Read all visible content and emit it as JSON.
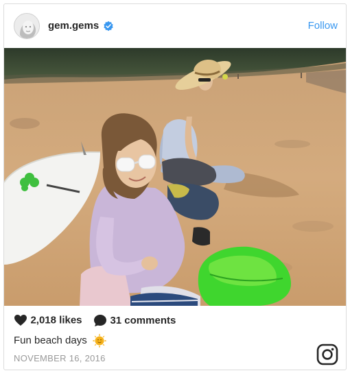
{
  "post": {
    "username": "gem.gems",
    "follow_label": "Follow",
    "likes": "2,018 likes",
    "comments": "31 comments",
    "caption": "Fun beach days",
    "date": "NOVEMBER 16, 2016"
  },
  "icons": {
    "verified": "verified-badge-icon",
    "like": "heart-icon",
    "comment": "comment-bubble-icon",
    "emoji": "sun-emoji-icon",
    "brand": "instagram-logo"
  },
  "colors": {
    "link": "#3897f0",
    "verified": "#3897f0",
    "text": "#262626",
    "meta": "#999999",
    "border": "#dbdbdb"
  }
}
